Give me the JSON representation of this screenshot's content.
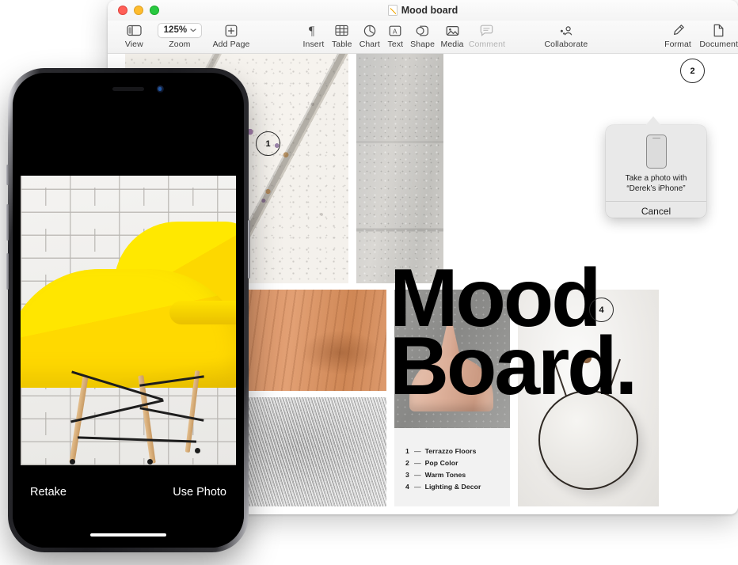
{
  "window": {
    "title": "Mood board",
    "zoom_level": "125%",
    "traffic_lights": [
      "close",
      "minimize",
      "maximize"
    ],
    "accent_colors": {
      "close": "#ff5f57",
      "minimize": "#febc2e",
      "maximize": "#28c840",
      "link_blue": "#1f60b5"
    }
  },
  "toolbar": {
    "items": [
      {
        "label": "View",
        "icon": "sidebar-icon"
      },
      {
        "label": "Zoom",
        "icon": "chevron-down-icon"
      },
      {
        "label": "Add Page",
        "icon": "plus-square-icon"
      },
      {
        "label": "Insert",
        "icon": "pilcrow-icon"
      },
      {
        "label": "Table",
        "icon": "table-icon"
      },
      {
        "label": "Chart",
        "icon": "chart-pie-icon"
      },
      {
        "label": "Text",
        "icon": "text-box-icon"
      },
      {
        "label": "Shape",
        "icon": "shape-icon"
      },
      {
        "label": "Media",
        "icon": "photo-icon"
      },
      {
        "label": "Comment",
        "icon": "comment-bubble-icon"
      },
      {
        "label": "Collaborate",
        "icon": "collaborate-icon"
      },
      {
        "label": "Format",
        "icon": "paintbrush-icon"
      },
      {
        "label": "Document",
        "icon": "document-icon"
      }
    ]
  },
  "document": {
    "heading_line1": "Mood",
    "heading_line2": "Board.",
    "badges": [
      "1",
      "2",
      "4"
    ],
    "legend": [
      {
        "number": "1",
        "dash": "—",
        "text": "Terrazzo Floors"
      },
      {
        "number": "2",
        "dash": "—",
        "text": "Pop Color"
      },
      {
        "number": "3",
        "dash": "—",
        "text": "Warm Tones"
      },
      {
        "number": "4",
        "dash": "—",
        "text": "Lighting & Decor"
      }
    ]
  },
  "popover": {
    "prompt_line1": "Take a photo with",
    "prompt_line2": "“Derek’s iPhone”",
    "cancel_label": "Cancel",
    "device_icon": "iphone-icon"
  },
  "phone": {
    "retake_label": "Retake",
    "use_photo_label": "Use Photo",
    "subject": "yellow-chair-photo"
  }
}
